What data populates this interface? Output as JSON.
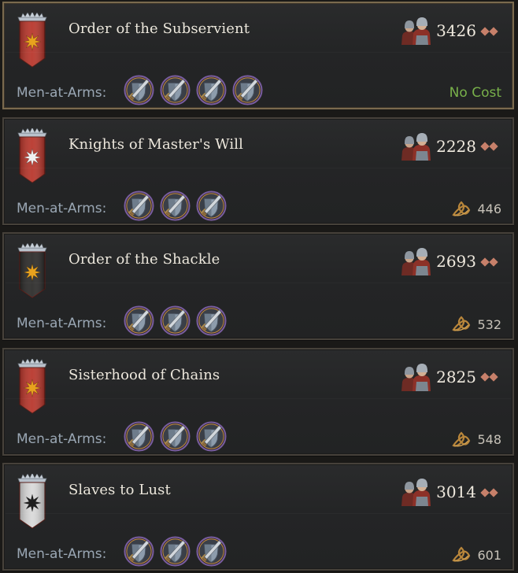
{
  "colors": {
    "banner_red": "#b8352a",
    "banner_black": "#2b2a29",
    "banner_white": "#d9d9d9",
    "emblem_gold": "#e8a21e",
    "emblem_white": "#f1f1f1",
    "emblem_black": "#1f1f1f",
    "no_cost_green": "#78b04a"
  },
  "orders": [
    {
      "name": "Order of the Subservient",
      "soldiers": "3426",
      "maa_label": "Men-at-Arms:",
      "maa_count": 4,
      "cost": "No Cost",
      "cost_icon": "",
      "banner": "red",
      "emblem": "gold"
    },
    {
      "name": "Knights of Master's Will",
      "soldiers": "2228",
      "maa_label": "Men-at-Arms:",
      "maa_count": 3,
      "cost": "446",
      "cost_icon": "gold-knot-icon",
      "banner": "red",
      "emblem": "white"
    },
    {
      "name": "Order of the Shackle",
      "soldiers": "2693",
      "maa_label": "Men-at-Arms:",
      "maa_count": 3,
      "cost": "532",
      "cost_icon": "gold-knot-icon",
      "banner": "black",
      "emblem": "gold"
    },
    {
      "name": "Sisterhood of Chains",
      "soldiers": "2825",
      "maa_label": "Men-at-Arms:",
      "maa_count": 3,
      "cost": "548",
      "cost_icon": "gold-knot-icon",
      "banner": "red",
      "emblem": "gold"
    },
    {
      "name": "Slaves to Lust",
      "soldiers": "3014",
      "maa_label": "Men-at-Arms:",
      "maa_count": 3,
      "cost": "601",
      "cost_icon": "gold-knot-icon",
      "banner": "white",
      "emblem": "black"
    }
  ]
}
